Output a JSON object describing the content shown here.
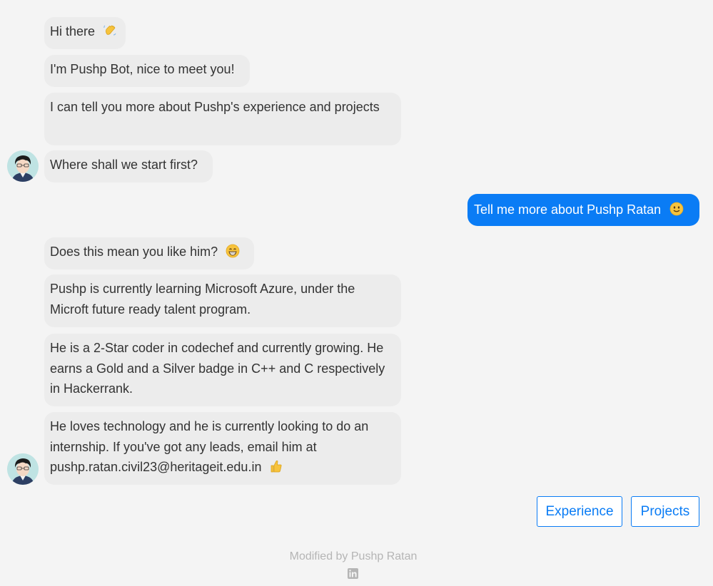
{
  "bot": {
    "messages_group1": [
      "Hi there",
      "I'm Pushp Bot, nice to meet you!",
      "I can tell you more about Pushp's experience and projects",
      "Where shall we start first?"
    ],
    "messages_group2": [
      "Does this mean you like him?",
      "Pushp is currently learning Microsoft Azure, under the Microft future ready talent program.",
      "He is a 2-Star coder in codechef and currently growing. He earns a Gold and a Silver badge in C++ and C respectively in Hackerrank.",
      "He loves technology and he is currently looking to do an internship. If you've got any leads, email him at pushp.ratan.civil23@heritageit.edu.in"
    ],
    "avatar_icon": "bot-avatar-icon"
  },
  "user": {
    "message": "Tell me more about Pushp Ratan"
  },
  "options": {
    "experience": "Experience",
    "projects": "Projects"
  },
  "footer": {
    "credit": "Modified by Pushp Ratan",
    "icon": "linkedin-icon"
  },
  "colors": {
    "user_bubble": "#0a7cf5",
    "bot_bubble": "#ececec",
    "background": "#f4f4f4",
    "footer_text": "#b5b5b5"
  },
  "emoji_icons": [
    "waving-hand-icon",
    "slightly-smiling-face-icon",
    "grinning-face-icon",
    "thumbs-up-icon"
  ]
}
